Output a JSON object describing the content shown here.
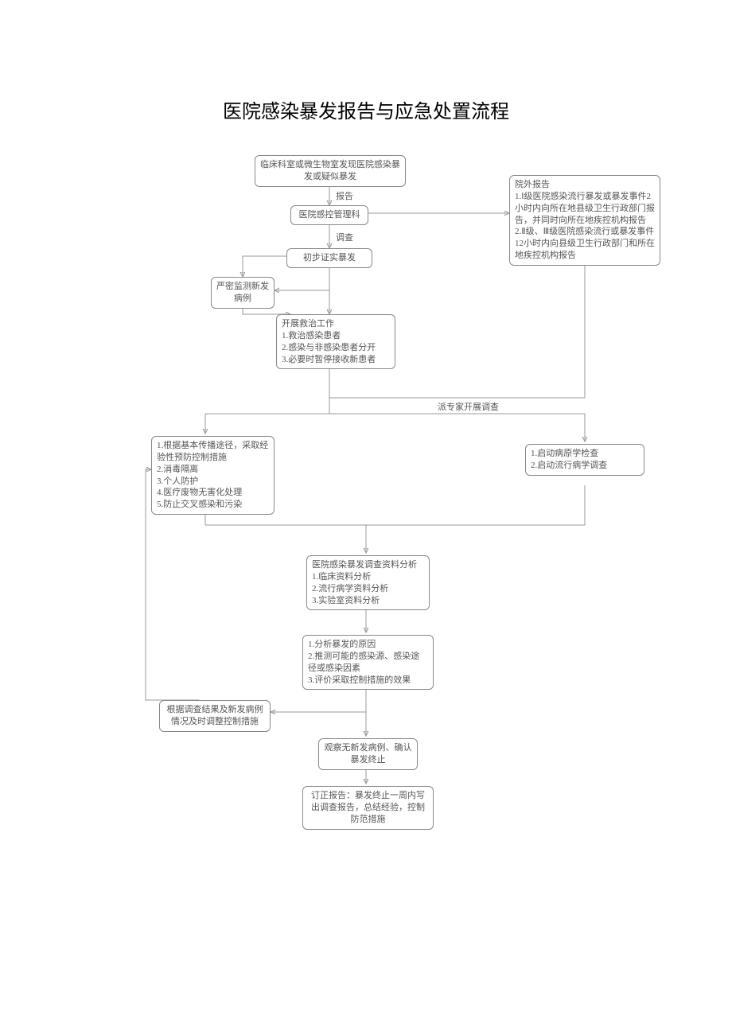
{
  "title": "医院感染暴发报告与应急处置流程",
  "nodes": {
    "n1": "临床科室或微生物室发现医院感染暴发或疑似暴发",
    "n2": "医院感控管理科",
    "n3": "初步证实暴发",
    "n4": "严密监测新发病例",
    "n5_lines": [
      "开展救治工作",
      "1.救治感染患者",
      "2.感染与非感染患者分开",
      "3.必要时暂停接收新患者"
    ],
    "n6_title": "院外报告",
    "n6_body": "1.Ⅰ级医院感染流行暴发或暴发事件2小时内向所在地县级卫生行政部门报告，并同时向所在地疾控机构报告 2.Ⅱ级、Ⅲ级医院感染流行或暴发事件12小时内向县级卫生行政部门和所在地疾控机构报告",
    "n7_lines": [
      "1.根据基本传播途径，采取经验性预防控制措施",
      "2.消毒隔离",
      "3.个人防护",
      "4.医疗废物无害化处理",
      "5.防止交叉感染和污染"
    ],
    "n8_lines": [
      "1.启动病原学检查",
      "2.启动流行病学调查"
    ],
    "n9_lines": [
      "医院感染暴发调查资料分析",
      "1.临床资料分析",
      "2.流行病学资料分析",
      "3.实验室资料分析"
    ],
    "n10_lines": [
      "1.分析暴发的原因",
      "2.推测可能的感染源、感染途径或感染因素",
      "3.评价采取控制措施的效果"
    ],
    "n11": "根据调查结果及新发病例情况及时调整控制措施",
    "n12": "观察无新发病例、确认暴发终止",
    "n13": "订正报告：暴发终止一周内写出调查报告，总结经验，控制防范措施"
  },
  "labels": {
    "l1": "报告",
    "l2": "调查",
    "l3": "派专家开展调查"
  }
}
